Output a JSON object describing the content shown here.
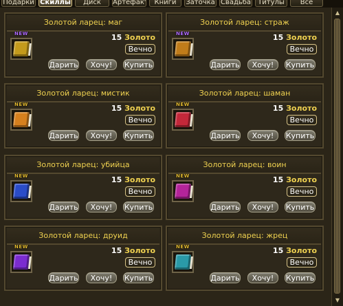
{
  "tabs": [
    {
      "label": "Подарки",
      "active": false
    },
    {
      "label": "Скиллы",
      "active": true
    },
    {
      "label": "Диск",
      "active": false
    },
    {
      "label": "Артефакт",
      "active": false
    },
    {
      "label": "Книги",
      "active": false
    },
    {
      "label": "Заточка",
      "active": false
    },
    {
      "label": "Свадьба",
      "active": false
    },
    {
      "label": "Титулы",
      "active": false
    },
    {
      "label": "Все",
      "active": false
    }
  ],
  "items": [
    {
      "title": "Золотой ларец: маг",
      "amount": "15",
      "currency": "Золото",
      "duration": "Вечно",
      "badge": "NEW",
      "badge_color": "#b06cff",
      "book_color": "#c39a1c",
      "gift": "Дарить",
      "want": "Хочу!",
      "buy": "Купить"
    },
    {
      "title": "Золотой ларец: страж",
      "amount": "15",
      "currency": "Золото",
      "duration": "Вечно",
      "badge": "NEW",
      "badge_color": "#b06cff",
      "book_color": "#c07c1a",
      "gift": "Дарить",
      "want": "Хочу!",
      "buy": "Купить"
    },
    {
      "title": "Золотой ларец: мистик",
      "amount": "15",
      "currency": "Золото",
      "duration": "Вечно",
      "badge": "NEW",
      "badge_color": "#e0b830",
      "book_color": "#d6801e",
      "gift": "Дарить",
      "want": "Хочу!",
      "buy": "Купить"
    },
    {
      "title": "Золотой ларец: шаман",
      "amount": "15",
      "currency": "Золото",
      "duration": "Вечно",
      "badge": "NEW",
      "badge_color": "#e0b830",
      "book_color": "#c4283a",
      "gift": "Дарить",
      "want": "Хочу!",
      "buy": "Купить"
    },
    {
      "title": "Золотой ларец: убийца",
      "amount": "15",
      "currency": "Золото",
      "duration": "Вечно",
      "badge": "NEW",
      "badge_color": "#e0b830",
      "book_color": "#2a4cc8",
      "gift": "Дарить",
      "want": "Хочу!",
      "buy": "Купить"
    },
    {
      "title": "Золотой ларец: воин",
      "amount": "15",
      "currency": "Золото",
      "duration": "Вечно",
      "badge": "NEW",
      "badge_color": "#e0b830",
      "book_color": "#b4249a",
      "gift": "Дарить",
      "want": "Хочу!",
      "buy": "Купить"
    },
    {
      "title": "Золотой ларец: друид",
      "amount": "15",
      "currency": "Золото",
      "duration": "Вечно",
      "badge": "NEW",
      "badge_color": "#e0b830",
      "book_color": "#7b2cd0",
      "gift": "Дарить",
      "want": "Хочу!",
      "buy": "Купить"
    },
    {
      "title": "Золотой ларец: жрец",
      "amount": "15",
      "currency": "Золото",
      "duration": "Вечно",
      "badge": "NEW",
      "badge_color": "#e0b830",
      "book_color": "#2a9aa8",
      "gift": "Дарить",
      "want": "Хочу!",
      "buy": "Купить"
    }
  ]
}
